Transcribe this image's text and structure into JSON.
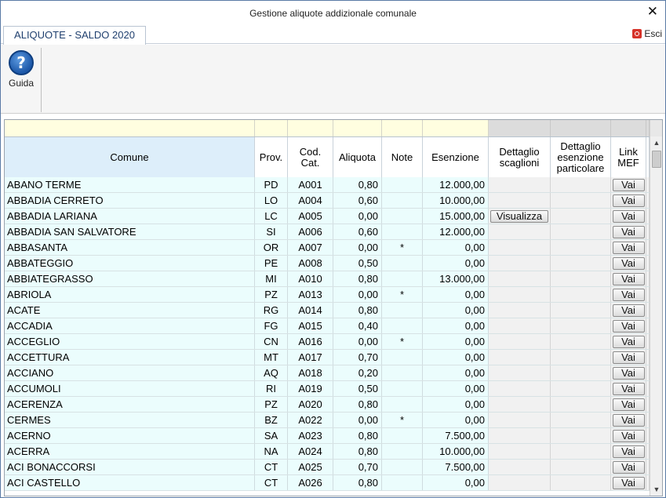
{
  "window": {
    "title": "Gestione aliquote addizionale comunale",
    "close_glyph": "✕",
    "close_icon": "close-icon"
  },
  "tabbar": {
    "active_tab": "ALIQUOTE - SALDO 2020",
    "exit_label": "Esci",
    "exit_icon": "power-exit-icon"
  },
  "ribbon": {
    "help_label": "Guida",
    "help_glyph": "?",
    "help_icon": "help-question-icon"
  },
  "grid": {
    "columns": [
      "Comune",
      "Prov.",
      "Cod.\nCat.",
      "Aliquota",
      "Note",
      "Esenzione",
      "Dettaglio\nscaglioni",
      "Dettaglio\nesenzione\nparticolare",
      "Link\nMEF"
    ],
    "button_vai": "Vai",
    "button_visualizza": "Visualizza",
    "rows": [
      {
        "comune": "ABANO TERME",
        "prov": "PD",
        "cod": "A001",
        "aliquota": "0,80",
        "note": "",
        "esenzione": "12.000,00",
        "dettaglio": ""
      },
      {
        "comune": "ABBADIA CERRETO",
        "prov": "LO",
        "cod": "A004",
        "aliquota": "0,60",
        "note": "",
        "esenzione": "10.000,00",
        "dettaglio": ""
      },
      {
        "comune": "ABBADIA LARIANA",
        "prov": "LC",
        "cod": "A005",
        "aliquota": "0,00",
        "note": "",
        "esenzione": "15.000,00",
        "dettaglio": "Visualizza"
      },
      {
        "comune": "ABBADIA SAN SALVATORE",
        "prov": "SI",
        "cod": "A006",
        "aliquota": "0,60",
        "note": "",
        "esenzione": "12.000,00",
        "dettaglio": ""
      },
      {
        "comune": "ABBASANTA",
        "prov": "OR",
        "cod": "A007",
        "aliquota": "0,00",
        "note": "*",
        "esenzione": "0,00",
        "dettaglio": ""
      },
      {
        "comune": "ABBATEGGIO",
        "prov": "PE",
        "cod": "A008",
        "aliquota": "0,50",
        "note": "",
        "esenzione": "0,00",
        "dettaglio": ""
      },
      {
        "comune": "ABBIATEGRASSO",
        "prov": "MI",
        "cod": "A010",
        "aliquota": "0,80",
        "note": "",
        "esenzione": "13.000,00",
        "dettaglio": ""
      },
      {
        "comune": "ABRIOLA",
        "prov": "PZ",
        "cod": "A013",
        "aliquota": "0,00",
        "note": "*",
        "esenzione": "0,00",
        "dettaglio": ""
      },
      {
        "comune": "ACATE",
        "prov": "RG",
        "cod": "A014",
        "aliquota": "0,80",
        "note": "",
        "esenzione": "0,00",
        "dettaglio": ""
      },
      {
        "comune": "ACCADIA",
        "prov": "FG",
        "cod": "A015",
        "aliquota": "0,40",
        "note": "",
        "esenzione": "0,00",
        "dettaglio": ""
      },
      {
        "comune": "ACCEGLIO",
        "prov": "CN",
        "cod": "A016",
        "aliquota": "0,00",
        "note": "*",
        "esenzione": "0,00",
        "dettaglio": ""
      },
      {
        "comune": "ACCETTURA",
        "prov": "MT",
        "cod": "A017",
        "aliquota": "0,70",
        "note": "",
        "esenzione": "0,00",
        "dettaglio": ""
      },
      {
        "comune": "ACCIANO",
        "prov": "AQ",
        "cod": "A018",
        "aliquota": "0,20",
        "note": "",
        "esenzione": "0,00",
        "dettaglio": ""
      },
      {
        "comune": "ACCUMOLI",
        "prov": "RI",
        "cod": "A019",
        "aliquota": "0,50",
        "note": "",
        "esenzione": "0,00",
        "dettaglio": ""
      },
      {
        "comune": "ACERENZA",
        "prov": "PZ",
        "cod": "A020",
        "aliquota": "0,80",
        "note": "",
        "esenzione": "0,00",
        "dettaglio": ""
      },
      {
        "comune": "CERMES",
        "prov": "BZ",
        "cod": "A022",
        "aliquota": "0,00",
        "note": "*",
        "esenzione": "0,00",
        "dettaglio": ""
      },
      {
        "comune": "ACERNO",
        "prov": "SA",
        "cod": "A023",
        "aliquota": "0,80",
        "note": "",
        "esenzione": "7.500,00",
        "dettaglio": ""
      },
      {
        "comune": "ACERRA",
        "prov": "NA",
        "cod": "A024",
        "aliquota": "0,80",
        "note": "",
        "esenzione": "10.000,00",
        "dettaglio": ""
      },
      {
        "comune": "ACI BONACCORSI",
        "prov": "CT",
        "cod": "A025",
        "aliquota": "0,70",
        "note": "",
        "esenzione": "7.500,00",
        "dettaglio": ""
      },
      {
        "comune": "ACI CASTELLO",
        "prov": "CT",
        "cod": "A026",
        "aliquota": "0,80",
        "note": "",
        "esenzione": "0,00",
        "dettaglio": ""
      }
    ]
  },
  "scrollbar": {
    "up_glyph": "▲",
    "down_glyph": "▼"
  },
  "colors": {
    "row_bg": "#ebfdfd",
    "filter_bg": "#fffee0",
    "header_comune_bg": "#ddeefa",
    "tab_text": "#1f3f6e",
    "exit_red": "#d6332a"
  }
}
